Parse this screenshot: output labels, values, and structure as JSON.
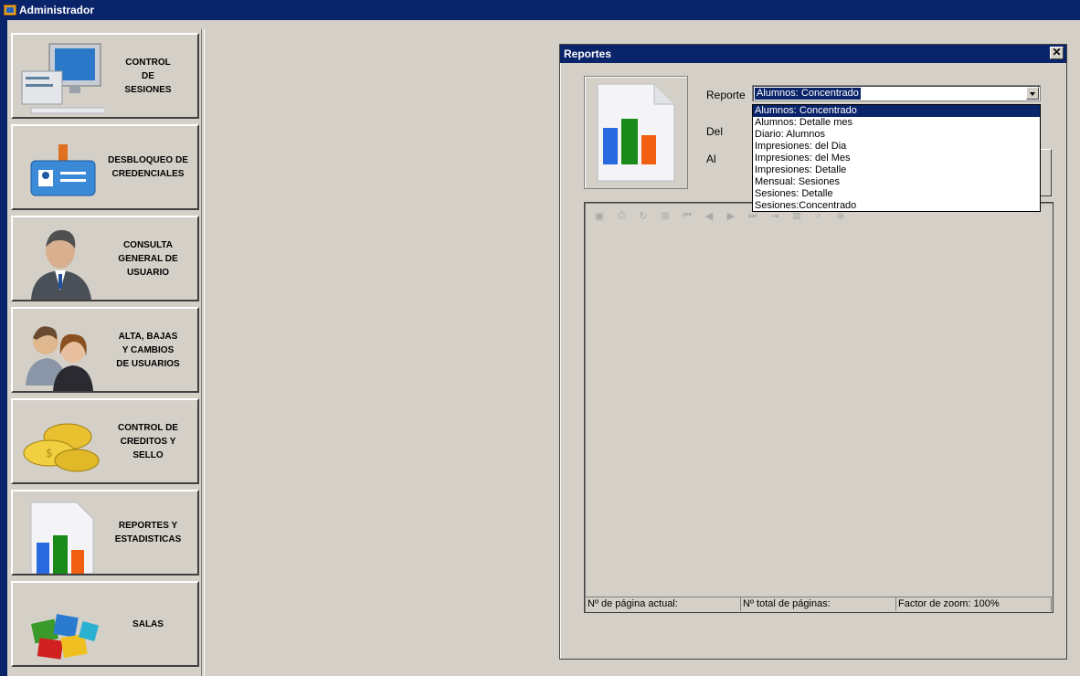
{
  "window": {
    "title": "Administrador"
  },
  "sidebar": {
    "items": [
      {
        "label": "CONTROL\nDE\nSESIONES"
      },
      {
        "label": "DESBLOQUEO DE\nCREDENCIALES"
      },
      {
        "label": "CONSULTA\nGENERAL DE\nUSUARIO"
      },
      {
        "label": "ALTA, BAJAS\nY CAMBIOS\nDE USUARIOS"
      },
      {
        "label": "CONTROL DE\nCREDITOS Y\nSELLO"
      },
      {
        "label": "REPORTES Y\nESTADISTICAS"
      },
      {
        "label": "SALAS"
      }
    ]
  },
  "dialog": {
    "title": "Reportes",
    "close_glyph": "✕",
    "labels": {
      "reporte": "Reporte",
      "del": "Del",
      "al": "Al"
    },
    "combo_value": "Alumnos: Concentrado",
    "options": [
      "Alumnos: Concentrado",
      "Alumnos: Detalle mes",
      "Diario: Alumnos",
      "Impresiones: del Dia",
      "Impresiones: del Mes",
      "Impresiones: Detalle",
      "Mensual:  Sesiones",
      "Sesiones: Detalle",
      "Sesiones:Concentrado"
    ],
    "viewer": {
      "status": {
        "current_page": "Nº de página actual:",
        "total_pages": "Nº total de páginas:",
        "zoom": "Factor de zoom: 100%"
      }
    }
  },
  "colors": {
    "titlebar": "#0a246a",
    "face": "#d4d0c8",
    "bar_blue": "#2a6ae0",
    "bar_green": "#1a8a1a",
    "bar_orange": "#f06010"
  }
}
